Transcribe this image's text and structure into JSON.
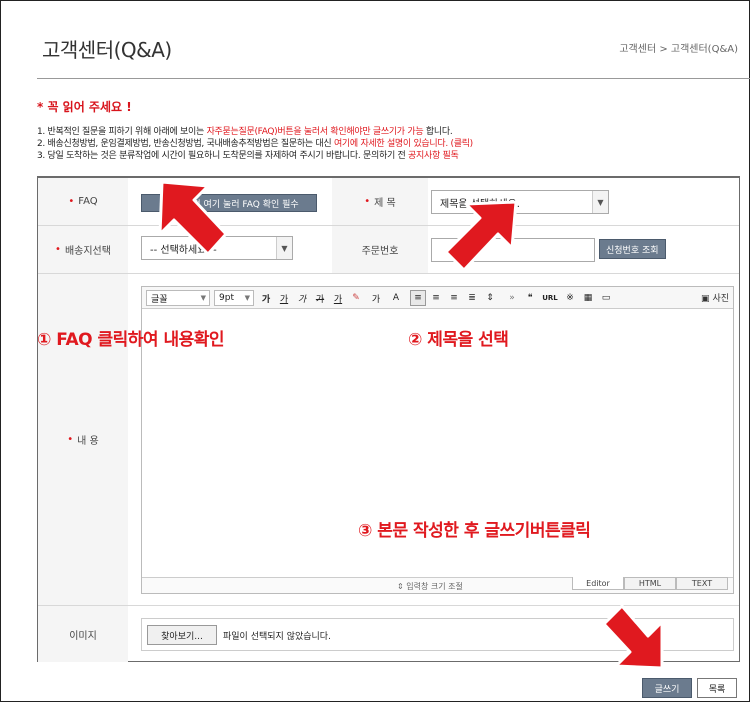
{
  "header": {
    "title": "고객센터(Q&A)",
    "breadcrumb": "고객센터 > 고객센터(Q&A)"
  },
  "notice": {
    "heading": "* 꼭 읽어 주세요 !",
    "line1_a": "1. 반복적인 질문을 피하기 위해 아래에 보이는 ",
    "line1_red": "자주묻는질문(FAQ)버튼을 눌러서 확인해야만 글쓰기가 가능",
    "line1_b": " 합니다.",
    "line2_a": "2. 배송신청방법, 운임결제방법, 반송신청방법, 국내배송추적방법은 질문하는 대신 ",
    "line2_red": "여기에 자세한 설명이 있습니다. (클릭)",
    "line3_a": "3. 당일 도착하는 것은 분류작업에 시간이 필요하니 도착문의를 자제하여 주시기 바랍니다. 문의하기 전 ",
    "line3_red": "공지사항 필독"
  },
  "form": {
    "faq_label": "FAQ",
    "faq_button": "질문하기전 여기 눌러 FAQ 확인 필수",
    "subject_label": "제 목",
    "subject_select": "제목을 선택하세요.",
    "shipping_label": "배송지선택",
    "shipping_select": "-- 선택하세요 --",
    "order_label": "주문번호",
    "order_button": "신청번호 조회",
    "content_label": "내 용",
    "image_label": "이미지",
    "file_button": "찾아보기...",
    "file_status": "파일이 선택되지 않았습니다."
  },
  "editor": {
    "font_select": "글꼴",
    "size_select": "9pt",
    "photo_button": "사진",
    "resize_label": "⇕ 입력창 크기 조절",
    "tabs": [
      "Editor",
      "HTML",
      "TEXT"
    ],
    "toolbar_glyphs": {
      "bold": "가",
      "underline": "가",
      "italic": "가",
      "strike": "가",
      "fontcolor": "가",
      "sup": "가",
      "quote": "❝",
      "url": "URL",
      "special": "※"
    }
  },
  "annotations": {
    "step1": "① FAQ 클릭하여 내용확인",
    "step2": "② 제목을 선택",
    "step3": "③ 본문 작성한 후 글쓰기버튼클릭"
  },
  "actions": {
    "write": "글쓰기",
    "list": "목록"
  },
  "colors": {
    "accent_red": "#e0191f",
    "button_blue_gray": "#6b7b8e"
  }
}
